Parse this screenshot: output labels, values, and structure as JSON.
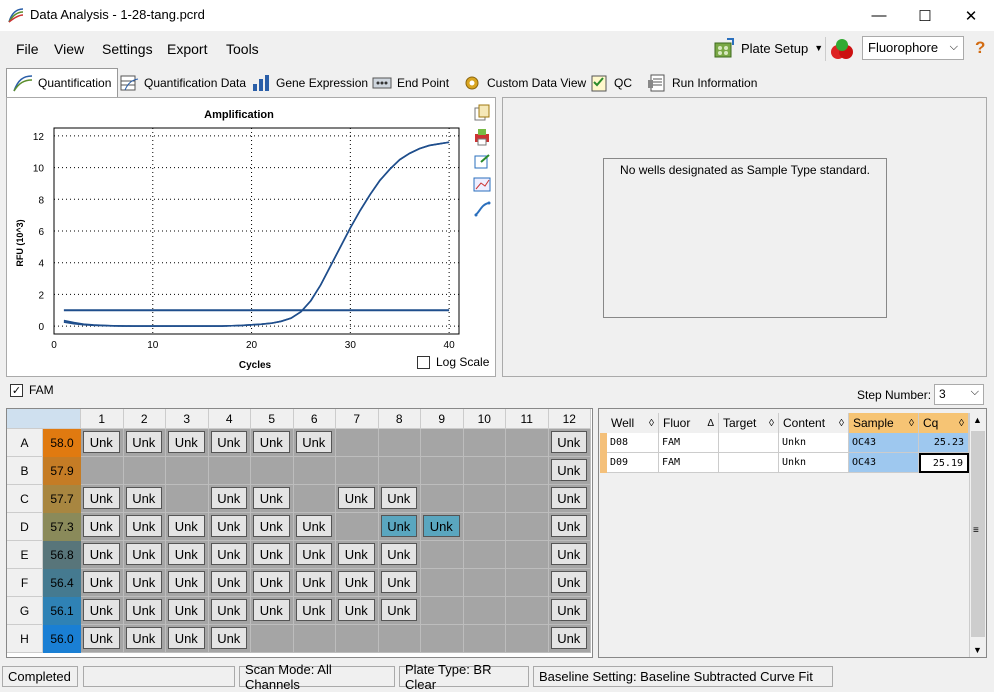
{
  "window": {
    "title": "Data Analysis - 1-28-tang.pcrd",
    "minimize": "—",
    "maximize": "☐",
    "close": "✕"
  },
  "menu": {
    "file": "File",
    "view": "View",
    "settings": "Settings",
    "export": "Export",
    "tools": "Tools"
  },
  "toolbar": {
    "plate_setup": "Plate Setup",
    "fluorophore": "Fluorophore",
    "help": "?"
  },
  "tabs": [
    "Quantification",
    "Quantification Data",
    "Gene Expression",
    "End Point",
    "Custom Data View",
    "QC",
    "Run Information"
  ],
  "chart": {
    "log_scale_label": "Log Scale"
  },
  "chart_data": {
    "type": "line",
    "title": "Amplification",
    "xlabel": "Cycles",
    "ylabel": "RFU (10^3)",
    "xlim": [
      0,
      41
    ],
    "ylim": [
      -0.5,
      12.5
    ],
    "xticks": [
      0,
      10,
      20,
      30,
      40
    ],
    "yticks": [
      0,
      2,
      4,
      6,
      8,
      10,
      12
    ],
    "grid": true,
    "threshold": 1.0,
    "series": [
      {
        "x": [
          1,
          2,
          3,
          4,
          5,
          6,
          7,
          8,
          9,
          10,
          11,
          12,
          13,
          14,
          15,
          16,
          17,
          18,
          19,
          20,
          21,
          22,
          23,
          24,
          25,
          26,
          27,
          28,
          29,
          30,
          31,
          32,
          33,
          34,
          35,
          36,
          37,
          38,
          39,
          40
        ],
        "values": [
          0.35,
          0.22,
          0.12,
          0.07,
          0.04,
          0.02,
          0.01,
          0.0,
          0.0,
          0.0,
          0.0,
          0.0,
          0.0,
          0.0,
          0.0,
          0.0,
          0.0,
          0.02,
          0.04,
          0.08,
          0.12,
          0.18,
          0.3,
          0.5,
          0.9,
          1.6,
          2.6,
          3.8,
          5.0,
          6.2,
          7.3,
          8.3,
          9.2,
          9.9,
          10.5,
          10.9,
          11.2,
          11.4,
          11.5,
          11.6
        ]
      },
      {
        "x": [
          1,
          2,
          3,
          4,
          5,
          6,
          7,
          8,
          9,
          10,
          11,
          12,
          13,
          14,
          15,
          16,
          17,
          18,
          19,
          20,
          21,
          22,
          23,
          24,
          25,
          26,
          27,
          28,
          29,
          30,
          31,
          32,
          33,
          34,
          35,
          36,
          37,
          38,
          39,
          40
        ],
        "values": [
          0.25,
          0.15,
          0.09,
          0.05,
          0.03,
          0.01,
          0.0,
          0.0,
          0.0,
          0.0,
          0.0,
          0.0,
          0.0,
          0.0,
          0.0,
          0.0,
          0.0,
          0.02,
          0.04,
          0.08,
          0.12,
          0.18,
          0.3,
          0.5,
          0.9,
          1.6,
          2.6,
          3.8,
          5.0,
          6.2,
          7.3,
          8.3,
          9.2,
          9.9,
          10.5,
          10.9,
          11.2,
          11.4,
          11.5,
          11.6
        ]
      }
    ]
  },
  "std_message": "No wells designated as Sample Type standard.",
  "fam": {
    "label": "FAM",
    "step_label": "Step Number:",
    "step_value": "3"
  },
  "plate": {
    "cols": [
      "1",
      "2",
      "3",
      "4",
      "5",
      "6",
      "7",
      "8",
      "9",
      "10",
      "11",
      "12"
    ],
    "rows": [
      "A",
      "B",
      "C",
      "D",
      "E",
      "F",
      "G",
      "H"
    ],
    "temps": [
      "58.0",
      "57.9",
      "57.7",
      "57.3",
      "56.8",
      "56.4",
      "56.1",
      "56.0"
    ],
    "temp_colors": [
      "#e07a10",
      "#c57c25",
      "#a88640",
      "#8a8a5a",
      "#58757a",
      "#457a90",
      "#2f82b5",
      "#1a7fd4"
    ],
    "well_label": "Unk",
    "wells": [
      [
        1,
        1,
        1,
        1,
        1,
        1,
        0,
        0,
        0,
        0,
        0,
        1
      ],
      [
        0,
        0,
        0,
        0,
        0,
        0,
        0,
        0,
        0,
        0,
        0,
        1
      ],
      [
        1,
        1,
        0,
        1,
        1,
        0,
        1,
        1,
        0,
        0,
        0,
        1
      ],
      [
        1,
        1,
        1,
        1,
        1,
        1,
        0,
        2,
        2,
        0,
        0,
        1
      ],
      [
        1,
        1,
        1,
        1,
        1,
        1,
        1,
        1,
        0,
        0,
        0,
        1
      ],
      [
        1,
        1,
        1,
        1,
        1,
        1,
        1,
        1,
        0,
        0,
        0,
        1
      ],
      [
        1,
        1,
        1,
        1,
        1,
        1,
        1,
        1,
        0,
        0,
        0,
        1
      ],
      [
        1,
        1,
        1,
        1,
        0,
        0,
        0,
        0,
        0,
        0,
        0,
        1
      ]
    ]
  },
  "table": {
    "headers": [
      "Well",
      "Fluor",
      "Target",
      "Content",
      "Sample",
      "Cq"
    ],
    "rows": [
      [
        "D08",
        "FAM",
        "",
        "Unkn",
        "OC43",
        "25.23"
      ],
      [
        "D09",
        "FAM",
        "",
        "Unkn",
        "OC43",
        "25.19"
      ]
    ]
  },
  "status": {
    "state": "Completed",
    "scan_mode": "Scan Mode: All Channels",
    "plate_type": "Plate Type: BR Clear",
    "baseline": "Baseline Setting: Baseline Subtracted Curve Fit"
  }
}
